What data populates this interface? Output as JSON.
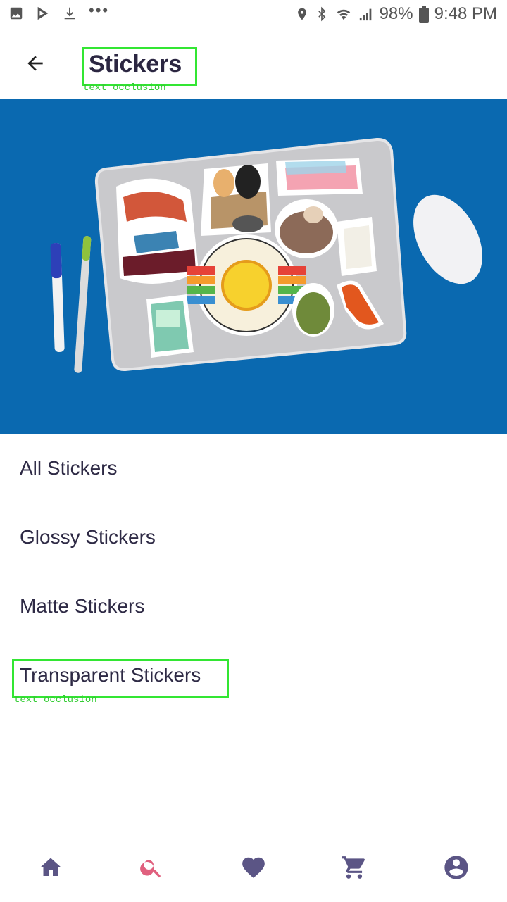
{
  "status_bar": {
    "battery": "98%",
    "time": "9:48 PM",
    "icons": [
      "image-icon",
      "play-store-icon",
      "download-icon",
      "more-dots-icon",
      "location-icon",
      "bluetooth-icon",
      "wifi-icon",
      "signal-icon",
      "battery-icon"
    ]
  },
  "app_bar": {
    "title": "Stickers",
    "back_icon": "arrow-left-icon",
    "annotation": "text occlusion"
  },
  "hero": {
    "description_icon": "laptop-stickers-banner"
  },
  "categories": [
    {
      "label": "All Stickers"
    },
    {
      "label": "Glossy Stickers"
    },
    {
      "label": "Matte Stickers"
    },
    {
      "label": "Transparent Stickers"
    }
  ],
  "category_annotation": "text occlusion",
  "bottom_nav": {
    "items": [
      "home-icon",
      "search-icon",
      "heart-icon",
      "cart-icon",
      "account-icon"
    ],
    "active": "search-icon",
    "colors": {
      "default": "#5b5585",
      "active": "#e0607e"
    }
  }
}
